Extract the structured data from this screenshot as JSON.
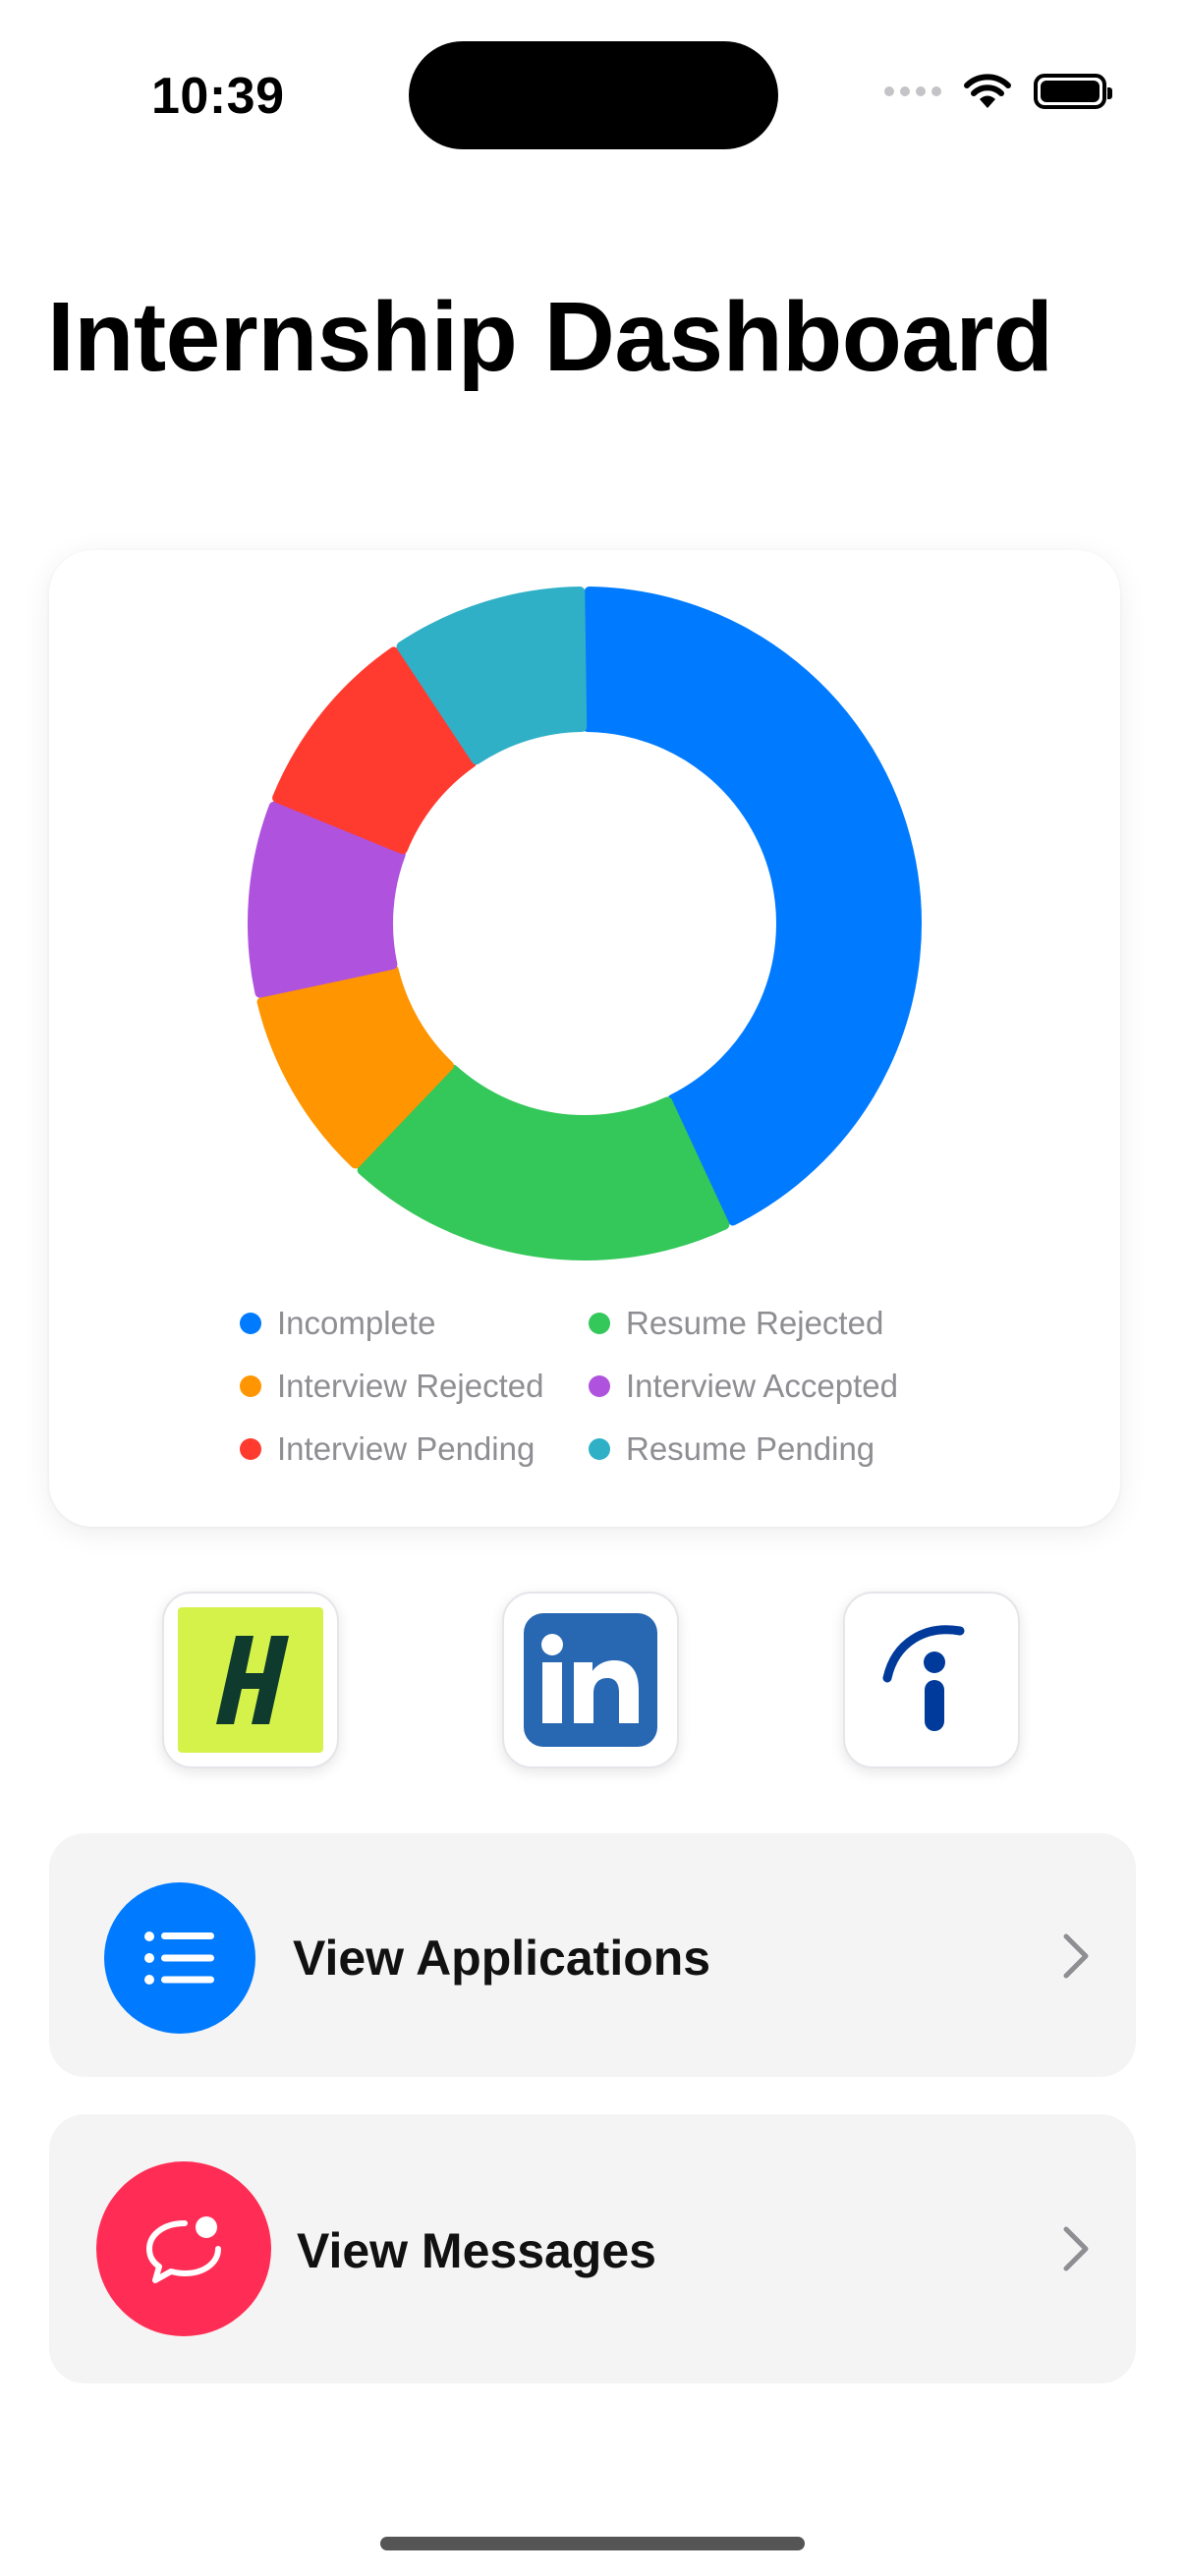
{
  "status_bar": {
    "time": "10:39"
  },
  "page": {
    "title": "Internship Dashboard"
  },
  "chart_data": {
    "type": "pie",
    "variant": "donut",
    "slices": [
      {
        "label": "Incomplete",
        "value": 9,
        "color": "#007AFF"
      },
      {
        "label": "Resume Rejected",
        "value": 4,
        "color": "#34C759"
      },
      {
        "label": "Interview Rejected",
        "value": 2,
        "color": "#FF9500"
      },
      {
        "label": "Interview Accepted",
        "value": 2,
        "color": "#AF52DE"
      },
      {
        "label": "Interview Pending",
        "value": 2,
        "color": "#FF3B30"
      },
      {
        "label": "Resume Pending",
        "value": 2,
        "color": "#30B0C7"
      }
    ]
  },
  "legend": [
    {
      "label": "Incomplete",
      "color": "#007AFF"
    },
    {
      "label": "Resume Rejected",
      "color": "#34C759"
    },
    {
      "label": "Interview Rejected",
      "color": "#FF9500"
    },
    {
      "label": "Interview Accepted",
      "color": "#AF52DE"
    },
    {
      "label": "Interview Pending",
      "color": "#FF3B30"
    },
    {
      "label": "Resume Pending",
      "color": "#30B0C7"
    }
  ],
  "apps": [
    {
      "name": "handshake-icon",
      "letter": "H",
      "bg": "#D4F24A",
      "fg": "#0E3B2E"
    },
    {
      "name": "linkedin-icon",
      "letter": "in",
      "bg": "#2867B2",
      "fg": "#ffffff"
    },
    {
      "name": "indeed-icon",
      "letter": "i",
      "bg": "#ffffff",
      "fg": "#003A9B"
    }
  ],
  "nav": {
    "applications": {
      "label": "View Applications",
      "icon": "list-icon",
      "color": "#007AFF"
    },
    "messages": {
      "label": "View Messages",
      "icon": "chat-bubble-icon",
      "color": "#FF2D55"
    }
  }
}
